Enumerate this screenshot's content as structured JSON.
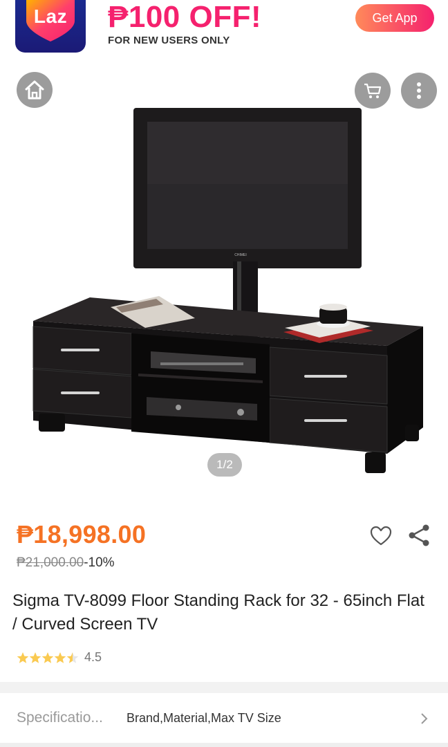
{
  "banner": {
    "logo_text": "Laz",
    "promo_headline": "₱100 OFF!",
    "promo_sub": "FOR NEW USERS ONLY",
    "get_app_label": "Get App",
    "colors": {
      "brand_pink": "#f5216e",
      "brand_navy": "#1b1a76"
    }
  },
  "gallery": {
    "icons": {
      "home": "home-icon",
      "cart": "cart-icon",
      "more": "more-vertical-icon"
    },
    "pager": "1/2",
    "brand_on_screen": "CHIMEI"
  },
  "product": {
    "price": "₱18,998.00",
    "original_price": "₱21,000.00",
    "discount": "-10%",
    "title": "Sigma TV-8099 Floor Standing Rack for 32 - 65inch Flat / Curved Screen TV",
    "rating_value": "4.5",
    "rating_stars": 4.5,
    "price_color": "#f57224"
  },
  "actions": {
    "wishlist_icon": "heart-outline-icon",
    "share_icon": "share-icon"
  },
  "specifications": {
    "label": "Specificatio...",
    "value": "Brand,Material,Max TV Size",
    "arrow_icon": "chevron-right-icon"
  }
}
